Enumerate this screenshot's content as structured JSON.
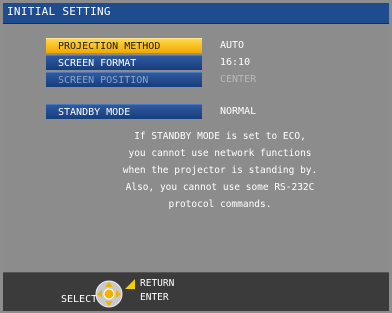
{
  "window": {
    "title": "INITIAL SETTING"
  },
  "menu": {
    "items": [
      {
        "label": "PROJECTION METHOD",
        "value": "AUTO",
        "state": "selected"
      },
      {
        "label": "SCREEN FORMAT",
        "value": "16:10",
        "state": "normal"
      },
      {
        "label": "SCREEN POSITION",
        "value": "CENTER",
        "state": "disabled"
      },
      {
        "label": "STANDBY MODE",
        "value": "NORMAL",
        "state": "normal"
      }
    ]
  },
  "note": {
    "lines": [
      "If STANDBY MODE is set to ECO,",
      "you cannot use network functions",
      "when the projector is standing by.",
      "Also, you cannot use some RS-232C",
      "protocol commands."
    ]
  },
  "footer": {
    "select_label": "SELECT",
    "return_label": "RETURN",
    "enter_label": "ENTER",
    "icons": [
      "directional-pad-icon",
      "return-arrow-icon"
    ]
  },
  "colors": {
    "title_bar": "#1f4c8f",
    "selected_item": "#f0a800",
    "item": "#1f4c8f",
    "footer": "#3b3b3b",
    "background": "#8c8c8c"
  }
}
